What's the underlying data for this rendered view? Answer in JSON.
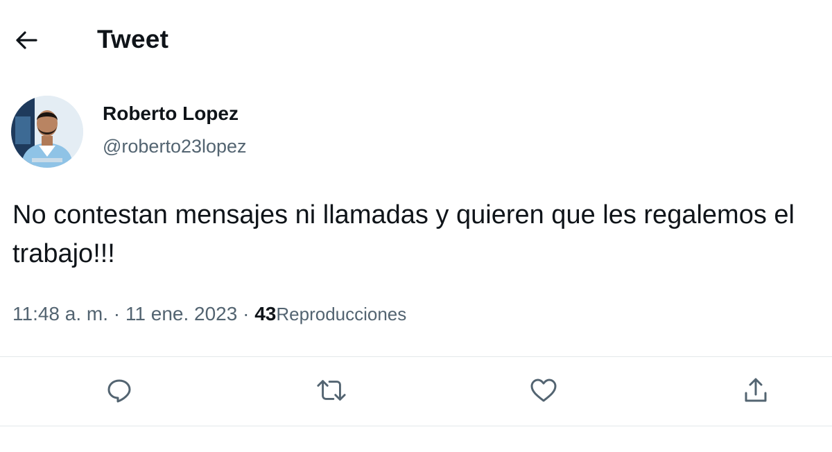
{
  "header": {
    "back_icon": "arrow-left-icon",
    "title": "Tweet"
  },
  "author": {
    "name": "Roberto Lopez",
    "handle": "@roberto23lopez"
  },
  "tweet": {
    "text": "No contestan mensajes ni llamadas y quieren que les regalemos el trabajo!!!",
    "time": "11:48 a. m.",
    "date": "11 ene. 2023",
    "separator": "·",
    "views_count": "43",
    "views_label": "Reproducciones"
  },
  "actions": [
    {
      "icon": "reply-icon"
    },
    {
      "icon": "retweet-icon"
    },
    {
      "icon": "like-icon"
    },
    {
      "icon": "share-icon"
    }
  ],
  "colors": {
    "text_primary": "#0f1419",
    "text_secondary": "#536471",
    "divider": "#e3e7ea",
    "icon": "#536471"
  }
}
